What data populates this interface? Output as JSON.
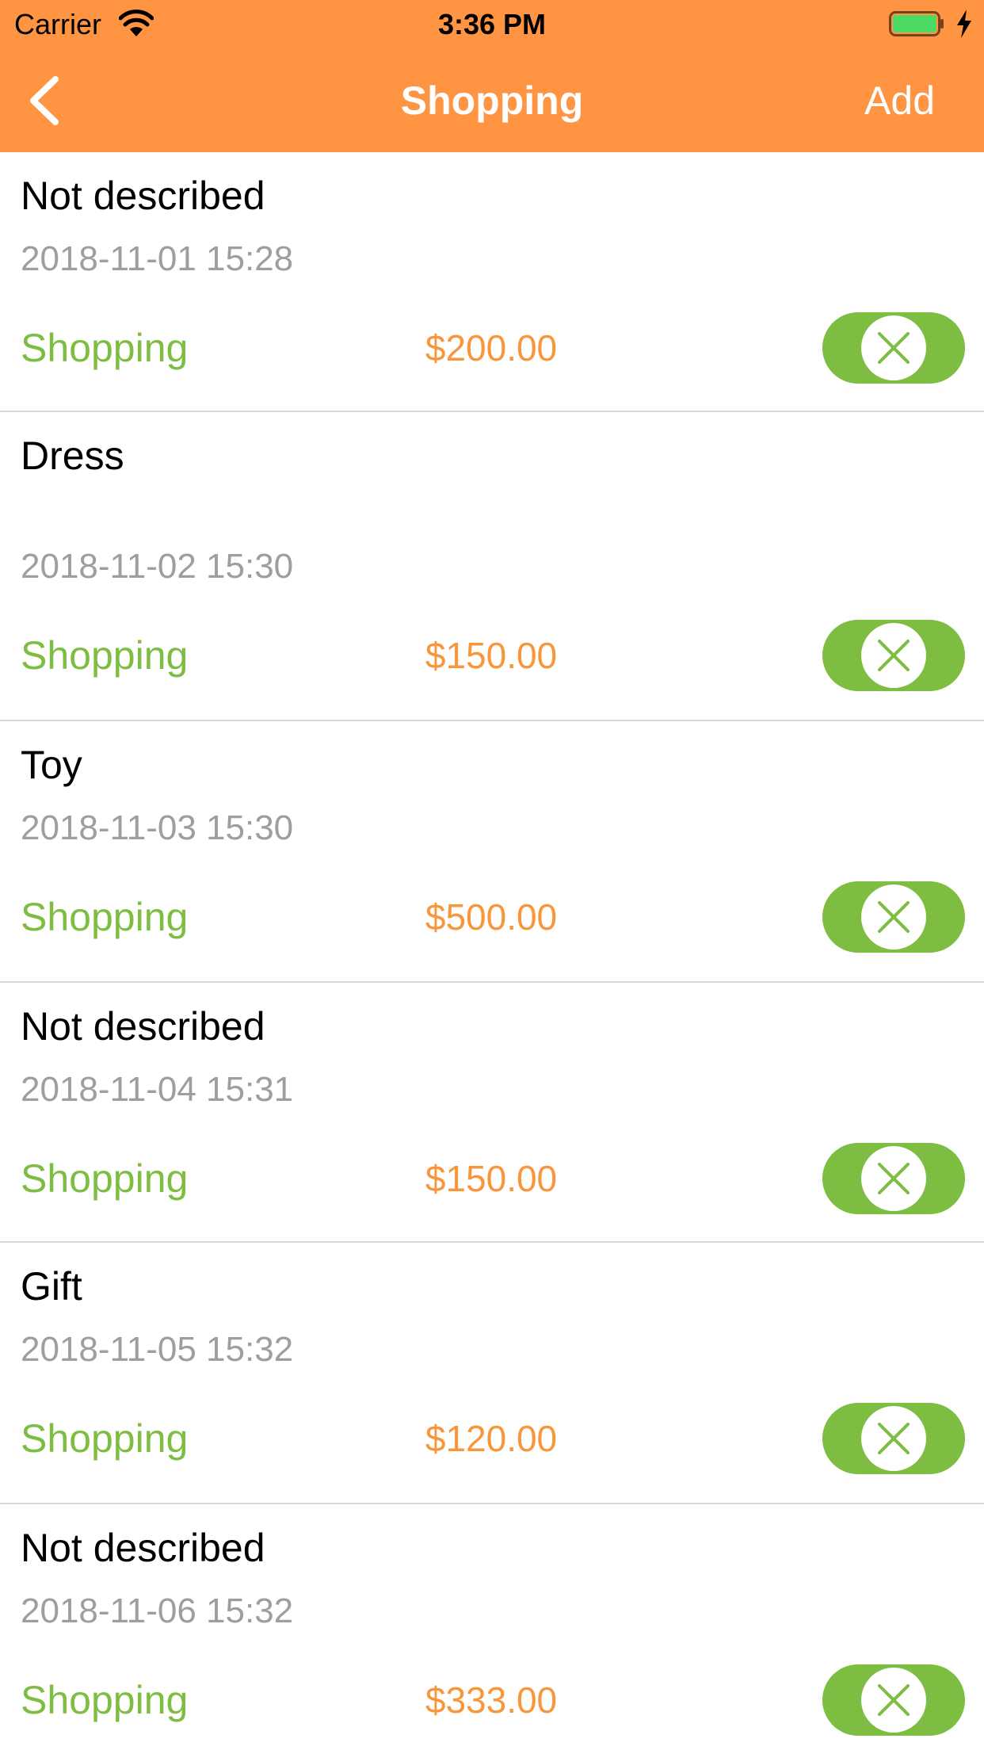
{
  "status_bar": {
    "carrier": "Carrier",
    "time": "3:36 PM"
  },
  "nav": {
    "title": "Shopping",
    "add_label": "Add"
  },
  "colors": {
    "nav_bg": "#FF9442",
    "category": "#7DBD41",
    "amount": "#F7963B",
    "date": "#9e9e9e",
    "delete_bg": "#7DBD41"
  },
  "records": [
    {
      "description": "Not described",
      "datetime": "2018-11-01 15:28",
      "category": "Shopping",
      "amount": "$200.00"
    },
    {
      "description": "Dress",
      "datetime": "2018-11-02 15:30",
      "category": "Shopping",
      "amount": "$150.00"
    },
    {
      "description": "Toy",
      "datetime": "2018-11-03 15:30",
      "category": "Shopping",
      "amount": "$500.00"
    },
    {
      "description": "Not described",
      "datetime": "2018-11-04 15:31",
      "category": "Shopping",
      "amount": "$150.00"
    },
    {
      "description": "Gift",
      "datetime": "2018-11-05 15:32",
      "category": "Shopping",
      "amount": "$120.00"
    },
    {
      "description": "Not described",
      "datetime": "2018-11-06 15:32",
      "category": "Shopping",
      "amount": "$333.00"
    }
  ]
}
